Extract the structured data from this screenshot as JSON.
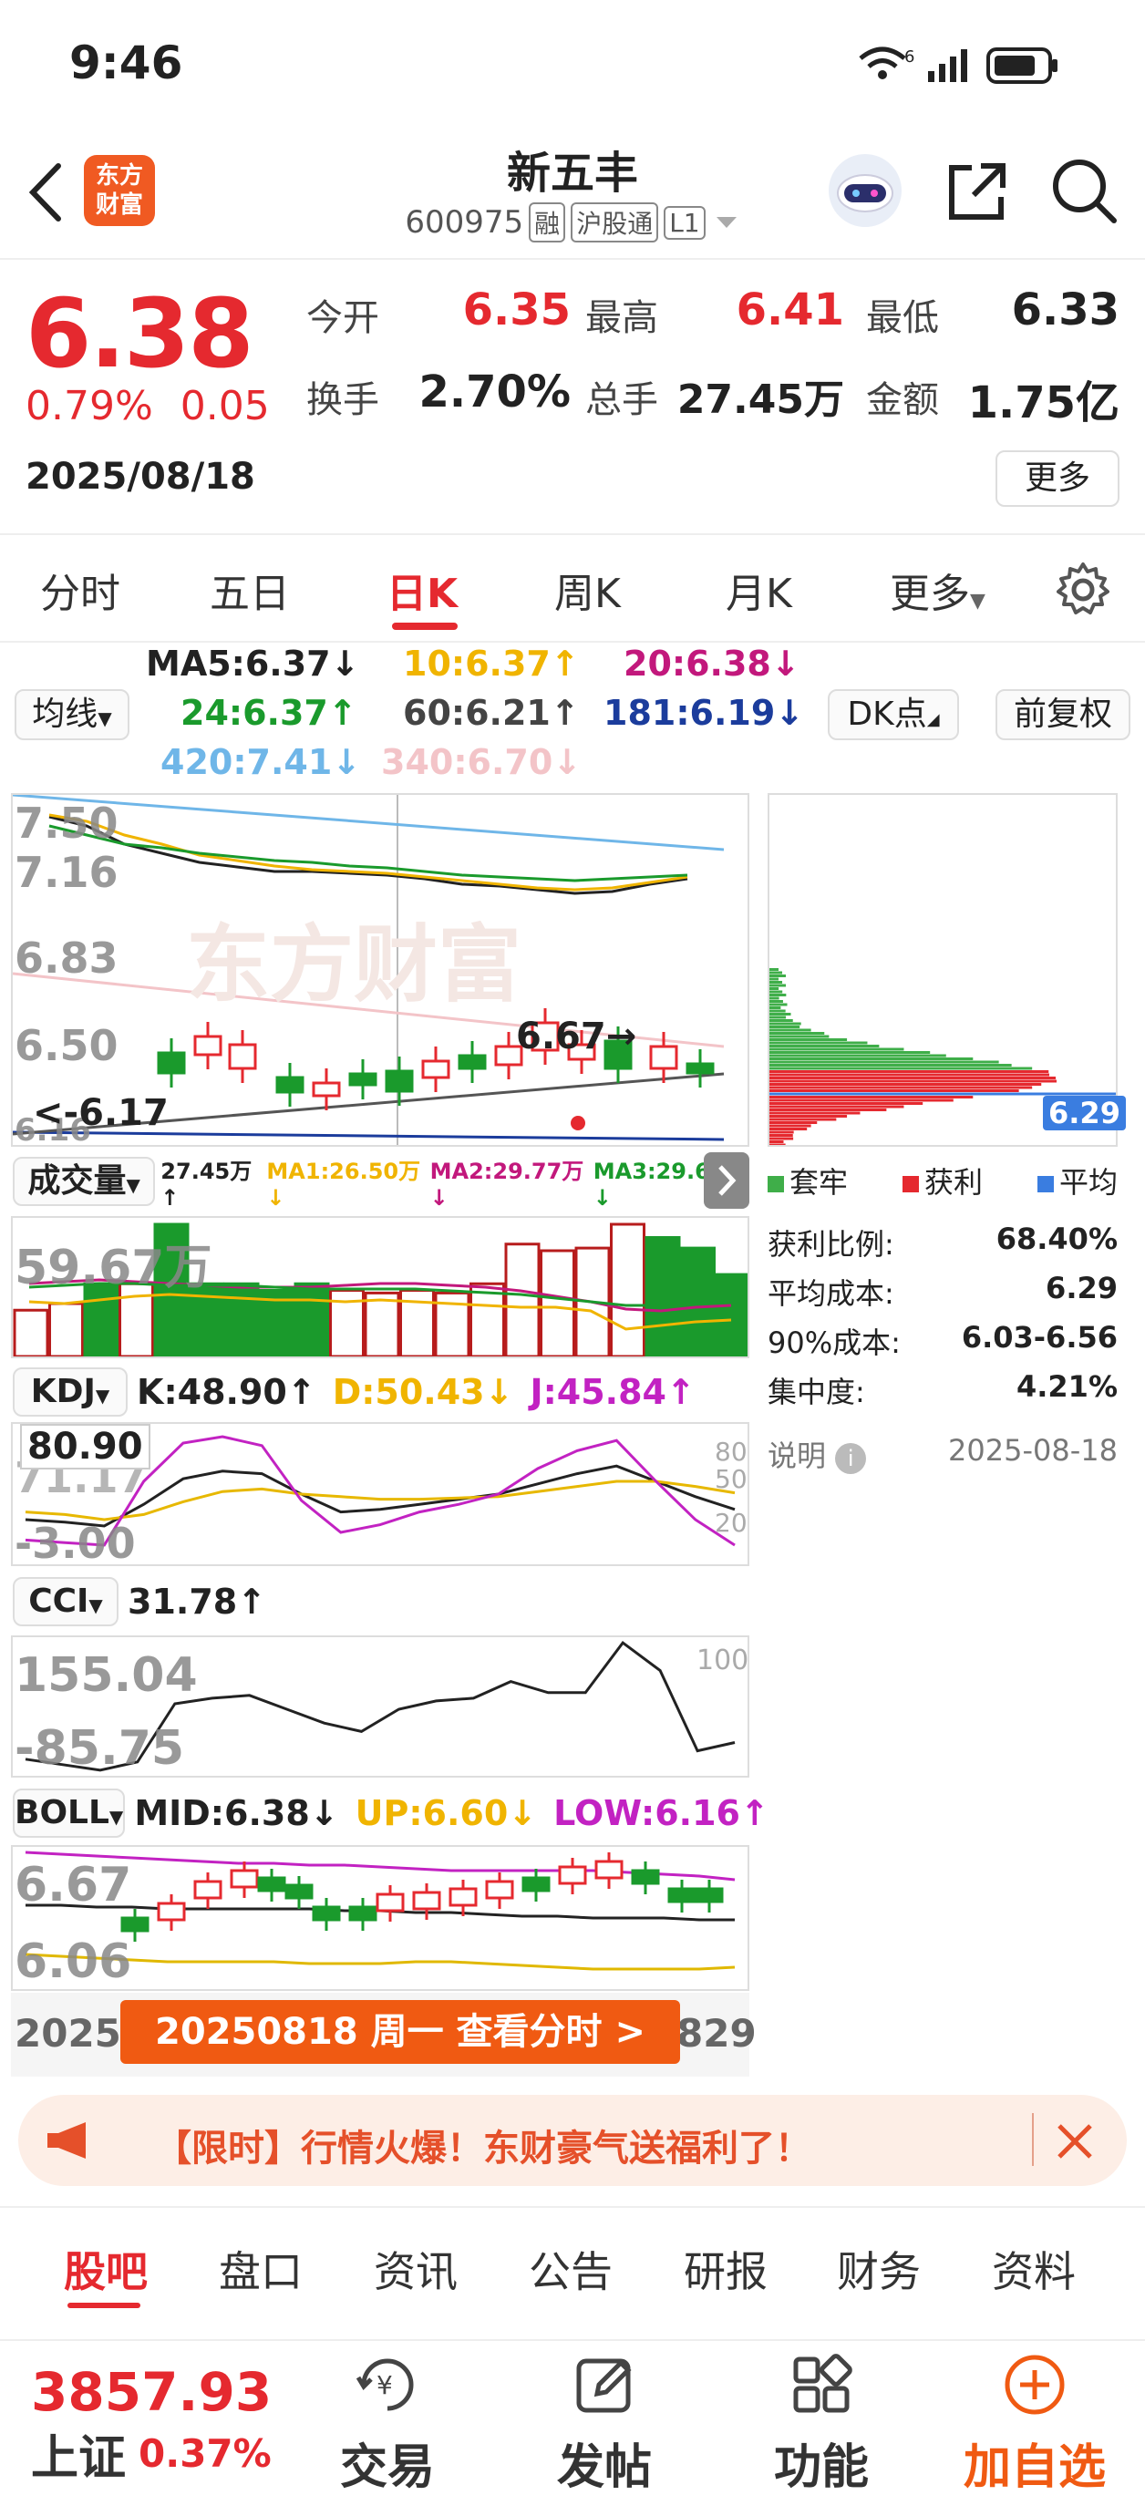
{
  "status_bar": {
    "time": "9:46",
    "network": "6"
  },
  "header": {
    "logo_text": "东方\n财富",
    "stock_name": "新五丰",
    "stock_code": "600975",
    "tags": [
      "融",
      "沪股通",
      "L1"
    ]
  },
  "quote": {
    "price": "6.38",
    "change_pct": "0.79%",
    "change_amt": "0.05",
    "date": "2025/08/18",
    "more_label": "更多",
    "fields": [
      {
        "label": "今开",
        "value": "6.35",
        "color": "#e5292f"
      },
      {
        "label": "最高",
        "value": "6.41",
        "color": "#e5292f"
      },
      {
        "label": "最低",
        "value": "6.33",
        "color": "#222222"
      },
      {
        "label": "换手",
        "value": "2.70%",
        "color": "#222222"
      },
      {
        "label": "总手",
        "value": "27.45万",
        "color": "#222222"
      },
      {
        "label": "金额",
        "value": "1.75亿",
        "color": "#222222"
      }
    ]
  },
  "period_tabs": [
    "分时",
    "五日",
    "日K",
    "周K",
    "月K",
    "更多"
  ],
  "active_period": "日K",
  "ma_legend": {
    "ma_button": "均线",
    "dk_button": "DK点",
    "adjust_button": "前复权",
    "items": [
      {
        "text": "MA5:6.37↓",
        "color": "#222222"
      },
      {
        "text": "10:6.37↑",
        "color": "#f0b400"
      },
      {
        "text": "20:6.38↓",
        "color": "#c2187c"
      },
      {
        "text": "24:6.37↑",
        "color": "#1a9a2c"
      },
      {
        "text": "60:6.21↑",
        "color": "#444444"
      },
      {
        "text": "181:6.19↓",
        "color": "#1b3c9c"
      },
      {
        "text": "420:7.41↓",
        "color": "#6fb6e8"
      },
      {
        "text": "340:6.70↓",
        "color": "#f3c4c8"
      }
    ]
  },
  "kline": {
    "axis_labels": [
      "7.50",
      "7.16",
      "6.83",
      "6.50",
      "6.16"
    ],
    "high_marker": "6.67",
    "low_marker": "6.17",
    "watermark": "东方财富"
  },
  "chip": {
    "current_price_tag": "6.29",
    "legend": [
      {
        "name": "套牢",
        "color": "#3fae49"
      },
      {
        "name": "获利",
        "color": "#e5292f"
      },
      {
        "name": "平均",
        "color": "#3a7de0"
      }
    ],
    "stats": [
      {
        "label": "获利比例:",
        "value": "68.40%"
      },
      {
        "label": "平均成本:",
        "value": "6.29"
      },
      {
        "label": "90%成本:",
        "value": "6.03-6.56"
      },
      {
        "label": "集中度:",
        "value": "4.21%"
      }
    ],
    "note_label": "说明",
    "note_date": "2025-08-18"
  },
  "volume": {
    "label": "成交量",
    "value": "27.45万↑",
    "ma1": "MA1:26.50万↓",
    "ma2": "MA2:29.77万↓",
    "ma3": "MA3:29.69万↓",
    "axis_label": "59.67万",
    "bars": [
      35,
      40,
      55,
      55,
      100,
      55,
      55,
      50,
      55,
      50,
      48,
      50,
      48,
      55,
      85,
      80,
      82,
      100,
      90,
      82,
      62
    ]
  },
  "kdj": {
    "label": "KDJ",
    "k": "K:48.90↑",
    "d": "D:50.43↓",
    "j": "J:45.84↑",
    "axis_top": "80.90",
    "axis_mid": "71.17",
    "axis_bottom": "-3.00",
    "ticks": [
      "80",
      "50",
      "20"
    ],
    "k_values": [
      30,
      28,
      25,
      42,
      62,
      68,
      66,
      50,
      36,
      38,
      42,
      46,
      50,
      58,
      66,
      72,
      60,
      48,
      38
    ],
    "d_values": [
      36,
      34,
      30,
      34,
      44,
      52,
      54,
      50,
      48,
      46,
      46,
      47,
      48,
      52,
      56,
      60,
      60,
      56,
      51
    ],
    "j_values": [
      14,
      12,
      10,
      60,
      90,
      95,
      88,
      45,
      20,
      26,
      36,
      42,
      50,
      70,
      84,
      92,
      60,
      30,
      10
    ]
  },
  "cci": {
    "label": "CCI",
    "value": "31.78↑",
    "axis_top": "155.04",
    "axis_bottom": "-85.75",
    "tick": "100",
    "values": [
      -60,
      -70,
      -80,
      -65,
      40,
      50,
      55,
      30,
      5,
      -10,
      30,
      45,
      50,
      80,
      60,
      60,
      150,
      100,
      -45,
      -30
    ]
  },
  "boll": {
    "label": "BOLL",
    "mid": "MID:6.38↓",
    "up": "UP:6.60↓",
    "low": "LOW:6.16↑",
    "axis_top": "6.67",
    "axis_bottom": "6.06"
  },
  "date_bar": {
    "left_text": "2025(",
    "right_text": "829",
    "tooltip": "20250818 周一 查看分时 >"
  },
  "promo": {
    "text": "【限时】行情火爆！东财豪气送福利了！"
  },
  "section_tabs": [
    "股吧",
    "盘口",
    "资讯",
    "公告",
    "研报",
    "财务",
    "资料"
  ],
  "active_section": "股吧",
  "bottom_nav": {
    "index_value": "3857.93",
    "index_name": "上证",
    "index_change": "0.37%",
    "items": [
      "交易",
      "发帖",
      "功能",
      "加自选"
    ]
  }
}
